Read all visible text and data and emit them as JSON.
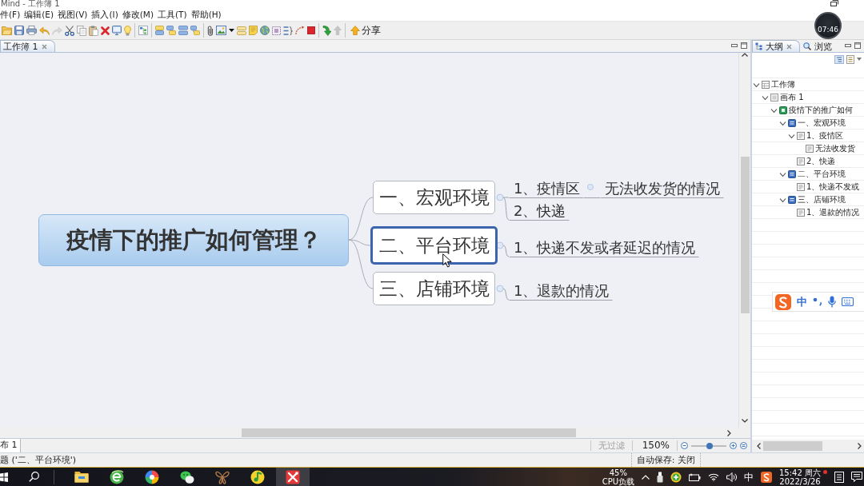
{
  "title_bar": {
    "title": "Mind - 工作簿 1"
  },
  "menu": [
    "件(F)",
    "编辑(E)",
    "视图(V)",
    "插入(I)",
    "修改(M)",
    "工具(T)",
    "帮助(H)"
  ],
  "toolbar": {
    "groups": [
      [
        {
          "kind": "open",
          "disabled": false
        },
        {
          "kind": "save",
          "disabled": false
        },
        {
          "kind": "print",
          "disabled": false
        },
        {
          "kind": "undo",
          "disabled": false
        },
        {
          "kind": "redo",
          "disabled": true
        },
        {
          "kind": "cut",
          "disabled": false
        },
        {
          "kind": "copy",
          "disabled": false
        },
        {
          "kind": "paste",
          "disabled": false
        },
        {
          "kind": "delete",
          "disabled": false
        },
        {
          "kind": "present",
          "disabled": false
        },
        {
          "kind": "idea",
          "disabled": false
        }
      ],
      [
        {
          "kind": "map",
          "disabled": false
        }
      ],
      [
        {
          "kind": "topic",
          "disabled": false
        },
        {
          "kind": "subtopic",
          "disabled": false
        },
        {
          "kind": "floating",
          "disabled": false
        },
        {
          "kind": "callout",
          "disabled": false
        }
      ],
      [
        {
          "kind": "attach",
          "disabled": false
        },
        {
          "kind": "image",
          "disabled": false
        },
        {
          "kind": "menu",
          "disabled": false
        },
        {
          "kind": "label",
          "disabled": false
        },
        {
          "kind": "note",
          "disabled": false
        },
        {
          "kind": "globe",
          "disabled": false
        },
        {
          "kind": "boundary",
          "disabled": false
        },
        {
          "kind": "summary",
          "disabled": false
        },
        {
          "kind": "relation",
          "disabled": false
        },
        {
          "kind": "stop",
          "disabled": false
        }
      ],
      [
        {
          "kind": "drilldown",
          "disabled": false
        },
        {
          "kind": "drillup",
          "disabled": true
        }
      ]
    ],
    "share": {
      "label": "分享"
    }
  },
  "recorder": {
    "time": "07:46"
  },
  "editor": {
    "tabs": [
      {
        "label": "工作簿 1",
        "selected": true
      }
    ],
    "sheet_tabs": [
      {
        "label": "布 1",
        "selected": true
      }
    ],
    "filter": {
      "label": "无过滤",
      "disabled": true
    },
    "zoom": {
      "reading": "150%",
      "level": 0.52
    }
  },
  "mind_map": {
    "central_topic": {
      "text": "疫情下的推广如何管理？",
      "selected": false
    },
    "topics": [
      {
        "text": "一、宏观环境",
        "selected": false,
        "children": [
          {
            "text": "1、疫情区",
            "selected": false,
            "children": [
              {
                "text": "无法收发货的情况",
                "selected": false
              }
            ]
          },
          {
            "text": "2、快递",
            "selected": false
          }
        ]
      },
      {
        "text": "二、平台环境",
        "selected": true,
        "children": [
          {
            "text": "1、快递不发或者延迟的情况",
            "selected": false
          }
        ]
      },
      {
        "text": "三、店铺环境",
        "selected": false,
        "children": [
          {
            "text": "1、退款的情况",
            "selected": false
          }
        ]
      }
    ]
  },
  "outline": {
    "tabs": [
      {
        "label": "大纲",
        "kind": "outline",
        "selected": true
      },
      {
        "label": "浏览",
        "kind": "overview",
        "selected": false
      }
    ],
    "tree": [
      {
        "label": "工作簿",
        "kind": "workbook",
        "expanded": true,
        "children": [
          {
            "label": "画布 1",
            "kind": "sheet",
            "expanded": true,
            "children": [
              {
                "label": "疫情下的推广如何",
                "kind": "central",
                "expanded": true,
                "children": [
                  {
                    "label": "一、宏观环境",
                    "kind": "main",
                    "expanded": true,
                    "children": [
                      {
                        "label": "1、疫情区",
                        "kind": "sub",
                        "expanded": true,
                        "children": [
                          {
                            "label": "无法收发货",
                            "kind": "sub"
                          }
                        ]
                      },
                      {
                        "label": "2、快递",
                        "kind": "sub"
                      }
                    ]
                  },
                  {
                    "label": "二、平台环境",
                    "kind": "main",
                    "expanded": true,
                    "children": [
                      {
                        "label": "1、快递不发或",
                        "kind": "sub"
                      }
                    ]
                  },
                  {
                    "label": "三、店铺环境",
                    "kind": "main",
                    "expanded": true,
                    "children": [
                      {
                        "label": "1、退款的情况",
                        "kind": "sub"
                      }
                    ]
                  }
                ]
              }
            ]
          }
        ]
      }
    ]
  },
  "ime_bar": {
    "mode": "中"
  },
  "status_bar": {
    "selection": "题 ('二、平台环境')",
    "autosave": "自动保存: 关闭"
  },
  "taskbar": {
    "apps": [
      {
        "kind": "folder",
        "selected": false
      },
      {
        "kind": "browser",
        "selected": false
      },
      {
        "kind": "pinwheel",
        "selected": false
      },
      {
        "kind": "chat",
        "selected": false
      },
      {
        "kind": "butterfly",
        "selected": false
      },
      {
        "kind": "music",
        "selected": false
      },
      {
        "kind": "mindmap",
        "selected": true
      }
    ],
    "cpu": {
      "value": "45%",
      "label": "CPU负载"
    },
    "ime": "中",
    "time": "15:42 周六",
    "date": "2022/3/26"
  }
}
